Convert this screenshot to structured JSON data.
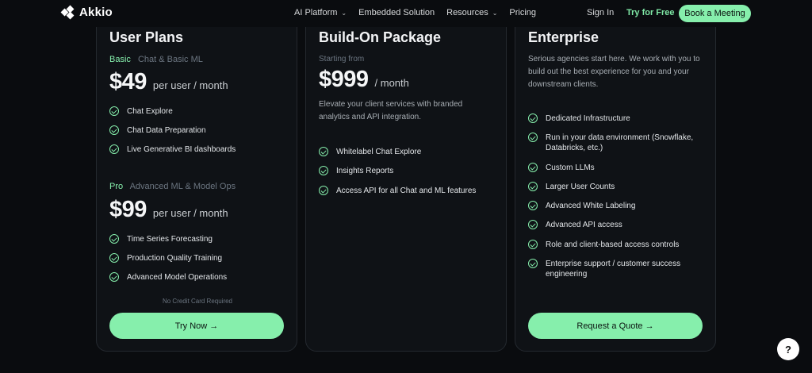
{
  "nav": {
    "logo": "Akkio",
    "links": [
      {
        "label": "AI Platform",
        "caret": true
      },
      {
        "label": "Embedded Solution",
        "caret": false
      },
      {
        "label": "Resources",
        "caret": true
      },
      {
        "label": "Pricing",
        "caret": false
      }
    ],
    "sign_in": "Sign In",
    "try_free": "Try for Free",
    "book": "Book a Meeting"
  },
  "plans": {
    "user": {
      "title": "User Plans",
      "basic": {
        "name": "Basic",
        "desc": "Chat & Basic ML",
        "price": "$49",
        "unit": "per user / month",
        "features": [
          "Chat Explore",
          "Chat Data Preparation",
          "Live Generative BI dashboards"
        ]
      },
      "pro": {
        "name": "Pro",
        "desc": "Advanced ML & Model Ops",
        "price": "$99",
        "unit": "per user / month",
        "features": [
          "Time Series Forecasting",
          "Production Quality Training",
          "Advanced Model Operations"
        ]
      },
      "note": "No Credit Card Required",
      "cta": "Try Now →"
    },
    "build": {
      "title": "Build-On Package",
      "starting": "Starting from",
      "price": "$999",
      "unit": "/ month",
      "desc": "Elevate your client services with branded analytics and API integration.",
      "features": [
        "Whitelabel Chat Explore",
        "Insights Reports",
        "Access API for all Chat and ML features"
      ]
    },
    "enterprise": {
      "title": "Enterprise",
      "desc": "Serious agencies start here. We work with you to build out the best experience for you and your downstream clients.",
      "features": [
        "Dedicated Infrastructure",
        "Run in your data environment (Snowflake, Databricks, etc.)",
        "Custom LLMs",
        "Larger User Counts",
        "Advanced White Labeling",
        "Advanced API access",
        "Role and client-based access controls",
        "Enterprise support / customer success engineering"
      ],
      "cta": "Request a Quote →"
    }
  },
  "help": "?",
  "colors": {
    "accent": "#86efac",
    "background": "#0a0c0f",
    "card": "#0f1216",
    "border": "#24292f"
  }
}
